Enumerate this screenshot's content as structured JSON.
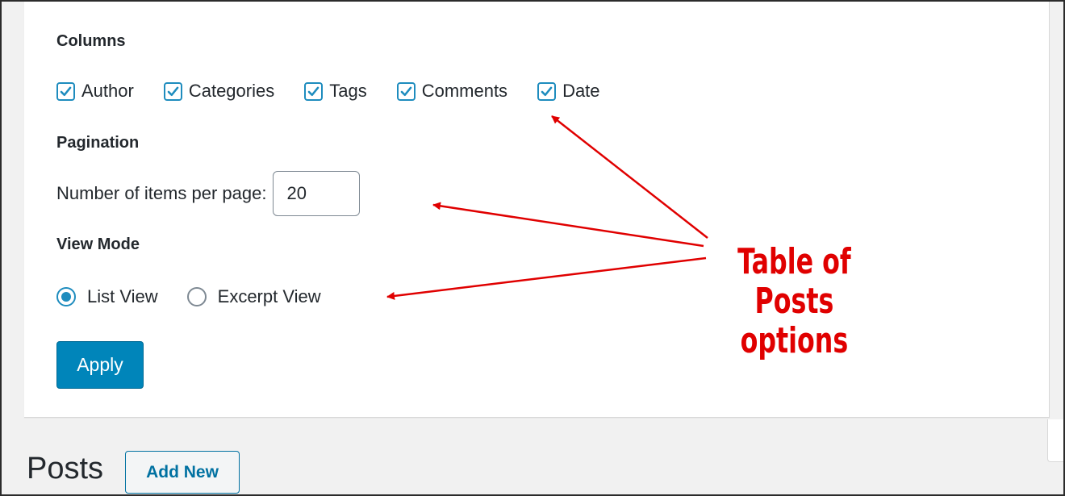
{
  "columns": {
    "legend": "Columns",
    "options": [
      {
        "label": "Author",
        "checked": true
      },
      {
        "label": "Categories",
        "checked": true
      },
      {
        "label": "Tags",
        "checked": true
      },
      {
        "label": "Comments",
        "checked": true
      },
      {
        "label": "Date",
        "checked": true
      }
    ]
  },
  "pagination": {
    "legend": "Pagination",
    "items_label": "Number of items per page:",
    "items_value": "20"
  },
  "view_mode": {
    "legend": "View Mode",
    "options": [
      {
        "label": "List View",
        "selected": true
      },
      {
        "label": "Excerpt View",
        "selected": false
      }
    ]
  },
  "apply_label": "Apply",
  "page": {
    "title": "Posts",
    "add_new_label": "Add New"
  },
  "annotation": {
    "line1": "Table of Posts",
    "line2": "options",
    "color": "#e00000"
  },
  "colors": {
    "accent": "#1e8cbe",
    "primary_button": "#0085ba",
    "link": "#0071a1",
    "background": "#f1f1f1"
  },
  "icons": {
    "checkbox_checked": "checkmark-icon"
  }
}
